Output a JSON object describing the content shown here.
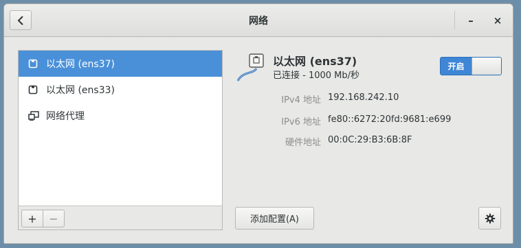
{
  "window": {
    "title": "网络"
  },
  "header": {
    "minimize_label": "–",
    "close_label": "×"
  },
  "device_list": {
    "items": [
      {
        "label": "以太网 (ens37)",
        "icon": "ethernet-icon",
        "selected": true
      },
      {
        "label": "以太网 (ens33)",
        "icon": "ethernet-icon",
        "selected": false
      },
      {
        "label": "网络代理",
        "icon": "network-proxy-icon",
        "selected": false
      }
    ],
    "toolbar": {
      "add_label": "+",
      "remove_label": "−"
    }
  },
  "detail": {
    "name": "以太网 (ens37)",
    "status": "已连接 - 1000 Mb/秒",
    "switch_label": "开启",
    "switch_state": "on",
    "properties": [
      {
        "label": "IPv4 地址",
        "value": "192.168.242.10"
      },
      {
        "label": "IPv6 地址",
        "value": "fe80::6272:20fd:9681:e699"
      },
      {
        "label": "硬件地址",
        "value": "00:0C:29:B3:6B:8F"
      }
    ],
    "add_config_label": "添加配置(A)"
  },
  "colors": {
    "accent": "#4a90d9",
    "switch_on": "#3f86d6"
  }
}
